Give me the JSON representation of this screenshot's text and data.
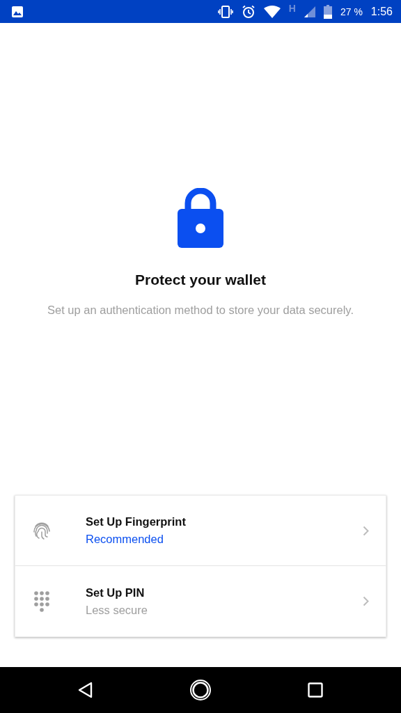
{
  "status_bar": {
    "network_type": "H",
    "battery": "27 %",
    "time": "1:56"
  },
  "title": "Protect your wallet",
  "description": "Set up an authentication method to store your data securely.",
  "options": [
    {
      "kind": "fingerprint",
      "title": "Set Up Fingerprint",
      "subtitle": "Recommended",
      "emphasized": true
    },
    {
      "kind": "pin",
      "title": "Set Up PIN",
      "subtitle": "Less secure",
      "emphasized": false
    }
  ]
}
